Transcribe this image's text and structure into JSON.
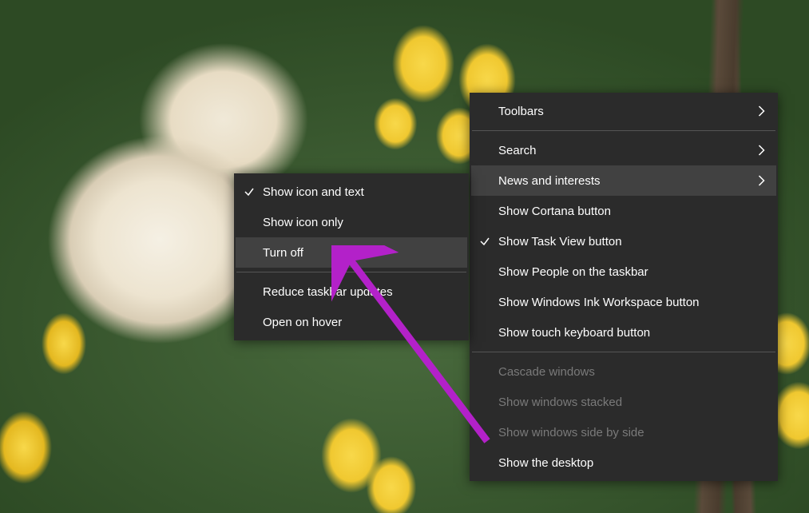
{
  "colors": {
    "menu_bg": "#2b2b2b",
    "menu_highlight": "#414141",
    "menu_text": "#ffffff",
    "menu_disabled": "#7a7a7a",
    "annotation_arrow": "#b321c9"
  },
  "primary_menu": {
    "items": [
      {
        "label": "Toolbars",
        "submenu": true
      },
      {
        "sep": true
      },
      {
        "label": "Search",
        "submenu": true
      },
      {
        "label": "News and interests",
        "submenu": true,
        "highlighted": true
      },
      {
        "label": "Show Cortana button"
      },
      {
        "label": "Show Task View button",
        "checked": true
      },
      {
        "label": "Show People on the taskbar"
      },
      {
        "label": "Show Windows Ink Workspace button"
      },
      {
        "label": "Show touch keyboard button"
      },
      {
        "sep": true
      },
      {
        "label": "Cascade windows",
        "disabled": true
      },
      {
        "label": "Show windows stacked",
        "disabled": true
      },
      {
        "label": "Show windows side by side",
        "disabled": true
      },
      {
        "label": "Show the desktop"
      }
    ]
  },
  "secondary_menu": {
    "items": [
      {
        "label": "Show icon and text",
        "checked": true
      },
      {
        "label": "Show icon only"
      },
      {
        "label": "Turn off",
        "highlighted": true
      },
      {
        "sep": true
      },
      {
        "label": "Reduce taskbar updates"
      },
      {
        "label": "Open on hover"
      }
    ]
  }
}
